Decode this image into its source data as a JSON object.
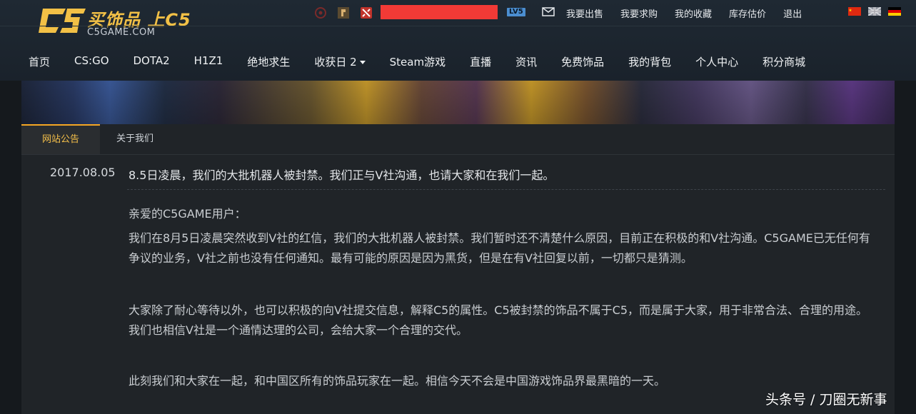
{
  "header": {
    "logo_text": "买饰品 上C5",
    "logo_sub": "C5GAME.COM",
    "level_badge": "LV5",
    "top_links": [
      "我要出售",
      "我要求购",
      "我的收藏",
      "库存估价",
      "退出"
    ],
    "flags": [
      "cn-flag",
      "uk-flag",
      "de-flag"
    ],
    "game_icons": [
      "csgo-icon",
      "pubg-icon",
      "dota2-icon"
    ]
  },
  "nav": {
    "items": [
      {
        "label": "首页"
      },
      {
        "label": "CS:GO"
      },
      {
        "label": "DOTA2"
      },
      {
        "label": "H1Z1"
      },
      {
        "label": "绝地求生"
      },
      {
        "label": "收获日 2",
        "dropdown": true
      },
      {
        "label": "Steam游戏"
      },
      {
        "label": "直播"
      },
      {
        "label": "资讯"
      },
      {
        "label": "免费饰品"
      },
      {
        "label": "我的背包"
      },
      {
        "label": "个人中心"
      },
      {
        "label": "积分商城"
      }
    ]
  },
  "tabs": [
    {
      "label": "网站公告",
      "active": true
    },
    {
      "label": "关于我们",
      "active": false
    }
  ],
  "post": {
    "date": "2017.08.05",
    "title": "8.5日凌晨，我们的大批机器人被封禁。我们正与V社沟通，也请大家和在我们一起。",
    "greeting": "亲爱的C5GAME用户：",
    "paragraph1": "我们在8月5日凌晨突然收到V社的红信，我们的大批机器人被封禁。我们暂时还不清楚什么原因，目前正在积极的和V社沟通。C5GAME已无任何有争议的业务，V社之前也没有任何通知。最有可能的原因是因为黑货，但是在有V社回复以前，一切都只是猜测。",
    "paragraph2": "大家除了耐心等待以外，也可以积极的向V社提交信息，解释C5的属性。C5被封禁的饰品不属于C5，而是属于大家，用于非常合法、合理的用途。我们也相信V社是一个通情达理的公司，会给大家一个合理的交代。",
    "paragraph3": "此刻我们和大家在一起，和中国区所有的饰品玩家在一起。相信今天不会是中国游戏饰品界最黑暗的一天。"
  },
  "watermark": "头条号 / 刀圈无新事",
  "colors": {
    "accent": "#f5a623",
    "username_redaction": "#f23a36",
    "level_badge": "#4b8ed0"
  }
}
